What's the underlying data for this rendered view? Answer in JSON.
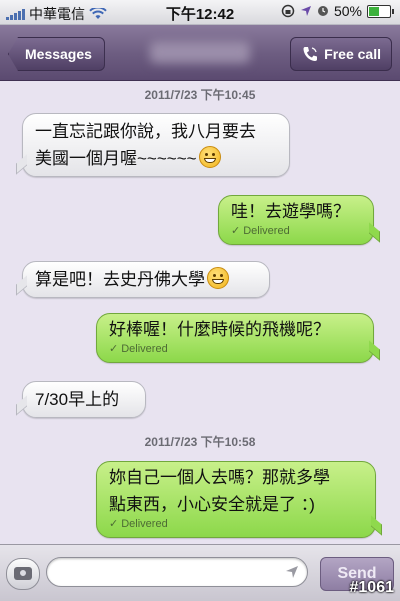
{
  "status_bar": {
    "carrier": "中華電信",
    "time": "下午12:42",
    "battery": "50%"
  },
  "nav": {
    "back_label": "Messages",
    "call_label": "Free call"
  },
  "conversation": {
    "timestamps": [
      "2011/7/23 下午10:45",
      "2011/7/23 下午10:58"
    ],
    "messages": [
      {
        "dir": "in",
        "lines": [
          "一直忘記跟你說，我八月要去",
          "美國一個月喔~~~~~~"
        ]
      },
      {
        "dir": "out",
        "text": "哇！去遊學嗎？",
        "status": "Delivered"
      },
      {
        "dir": "in",
        "text": "算是吧！去史丹佛大學"
      },
      {
        "dir": "out",
        "text": "好棒喔！什麼時候的飛機呢？",
        "status": "Delivered"
      },
      {
        "dir": "in",
        "text": "7/30早上的"
      },
      {
        "dir": "out",
        "lines": [
          "妳自己一個人去嗎？那就多學",
          "點東西，小心安全就是了 ：)"
        ],
        "status": "Delivered"
      }
    ]
  },
  "input_bar": {
    "text_value": "",
    "send_label": "Send"
  },
  "watermark": "#1061",
  "colors": {
    "nav_bar": "#6e5e82",
    "outgoing_bubble": "#8cd84a",
    "incoming_bubble": "#ffffff",
    "background": "#e8e3f0"
  }
}
